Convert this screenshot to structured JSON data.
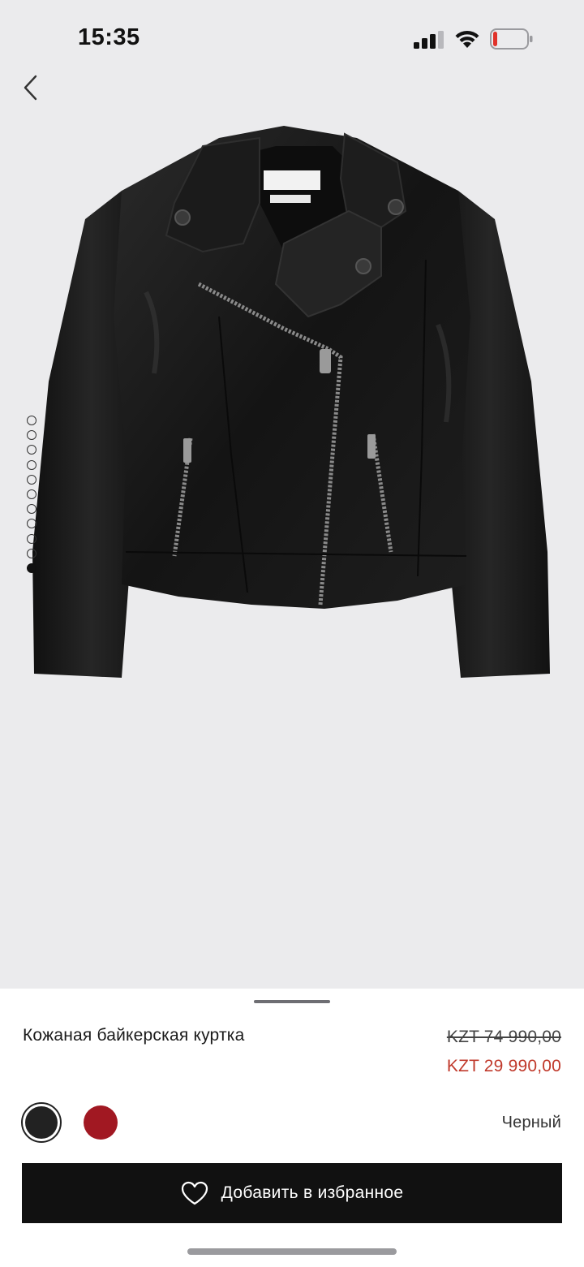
{
  "status_bar": {
    "time": "15:35",
    "icons": [
      "cellular-signal-icon",
      "wifi-icon",
      "battery-low-icon"
    ]
  },
  "navigation": {
    "back_icon": "chevron-left-icon"
  },
  "gallery": {
    "image": "black-leather-biker-jacket",
    "dot_count": 11,
    "active_dot": 11
  },
  "product": {
    "title": "Кожаная байкерская куртка",
    "price_old": "KZT 74 990,00",
    "price_new": "KZT 29 990,00",
    "selected_color": "Черный",
    "swatches": [
      {
        "name": "black",
        "color": "#222222",
        "selected": true
      },
      {
        "name": "red",
        "color": "#a11822",
        "selected": false
      }
    ]
  },
  "actions": {
    "favorite_label": "Добавить в избранное",
    "favorite_icon": "heart-icon"
  },
  "colors": {
    "sale_price": "#c0392b",
    "button_bg": "#111111",
    "background": "#ebebed"
  }
}
